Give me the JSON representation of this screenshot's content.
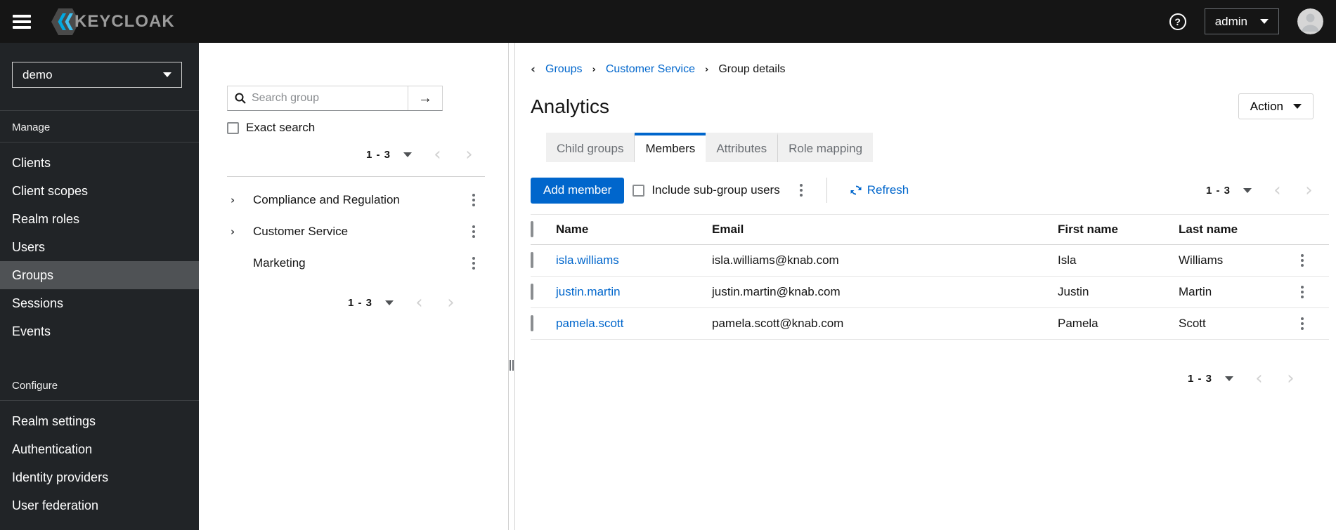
{
  "colors": {
    "accent": "#0066cc",
    "link": "#0066cc",
    "topbar_bg": "#151515",
    "sidebar_bg": "#212427",
    "sidebar_active_bg": "#4f5255",
    "tab_inactive_bg": "#f0f0f0"
  },
  "topbar": {
    "brand": "KEYCLOAK",
    "username": "admin",
    "icons": {
      "menu": "hamburger-icon",
      "help": "question-circle-icon",
      "help_glyph": "?",
      "avatar": "user-avatar"
    }
  },
  "sidebar": {
    "realm_selector": {
      "value": "demo"
    },
    "sections": [
      {
        "label": "Manage",
        "items": [
          "Clients",
          "Client scopes",
          "Realm roles",
          "Users",
          "Groups",
          "Sessions",
          "Events"
        ],
        "active_item": "Groups"
      },
      {
        "label": "Configure",
        "items": [
          "Realm settings",
          "Authentication",
          "Identity providers",
          "User federation"
        ]
      }
    ]
  },
  "tree_panel": {
    "search": {
      "placeholder": "Search group",
      "value": "",
      "submit_icon": "arrow-right-icon",
      "submit_glyph": "→"
    },
    "exact_search_label": "Exact search",
    "top_pagination": {
      "range": "1 - 3",
      "prev_glyph": "‹",
      "next_glyph": "›"
    },
    "groups": [
      {
        "label": "Compliance and Regulation",
        "expandable": true
      },
      {
        "label": "Customer Service",
        "expandable": true
      },
      {
        "label": "Marketing",
        "expandable": false
      }
    ],
    "expand_glyph": "›",
    "bottom_pagination": {
      "range": "1 - 3",
      "prev_glyph": "‹",
      "next_glyph": "›"
    }
  },
  "main": {
    "breadcrumb": {
      "back_glyph": "‹",
      "separator_glyph": "›",
      "items": [
        "Groups",
        "Customer Service",
        "Group details"
      ]
    },
    "title": "Analytics",
    "action_button_label": "Action",
    "tabs": [
      "Child groups",
      "Members",
      "Attributes",
      "Role mapping"
    ],
    "active_tab": "Members",
    "toolbar": {
      "add_member_label": "Add member",
      "include_subgroups_label": "Include sub-group users",
      "refresh_label": "Refresh",
      "pagination": {
        "range": "1 - 3",
        "prev_glyph": "‹",
        "next_glyph": "›"
      }
    },
    "table": {
      "headers": {
        "name": "Name",
        "email": "Email",
        "first": "First name",
        "last": "Last name"
      },
      "rows": [
        {
          "name": "isla.williams",
          "email": "isla.williams@knab.com",
          "first": "Isla",
          "last": "Williams"
        },
        {
          "name": "justin.martin",
          "email": "justin.martin@knab.com",
          "first": "Justin",
          "last": "Martin"
        },
        {
          "name": "pamela.scott",
          "email": "pamela.scott@knab.com",
          "first": "Pamela",
          "last": "Scott"
        }
      ],
      "pagination": {
        "range": "1 - 3",
        "prev_glyph": "‹",
        "next_glyph": "›"
      }
    }
  }
}
